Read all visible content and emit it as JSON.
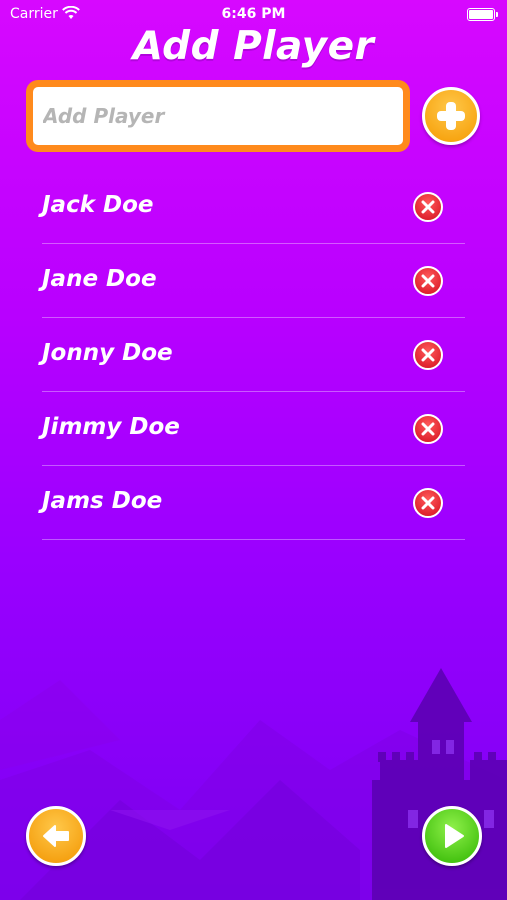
{
  "status_bar": {
    "carrier": "Carrier",
    "time": "6:46 PM"
  },
  "page": {
    "title": "Add Player"
  },
  "add_input": {
    "placeholder": "Add Player",
    "value": ""
  },
  "players": [
    {
      "name": "Jack Doe"
    },
    {
      "name": "Jane Doe"
    },
    {
      "name": "Jonny Doe"
    },
    {
      "name": "Jimmy Doe"
    },
    {
      "name": "Jams Doe"
    }
  ],
  "icons": {
    "add": "plus-icon",
    "delete": "close-icon",
    "back": "arrow-left-icon",
    "next": "play-icon"
  },
  "colors": {
    "background_top": "#d708ff",
    "background_bottom": "#7a00f2",
    "input_border": "#ff8a1c",
    "add_button": "#f5a400",
    "delete_button": "#d30f1f",
    "next_button": "#3cc000"
  }
}
